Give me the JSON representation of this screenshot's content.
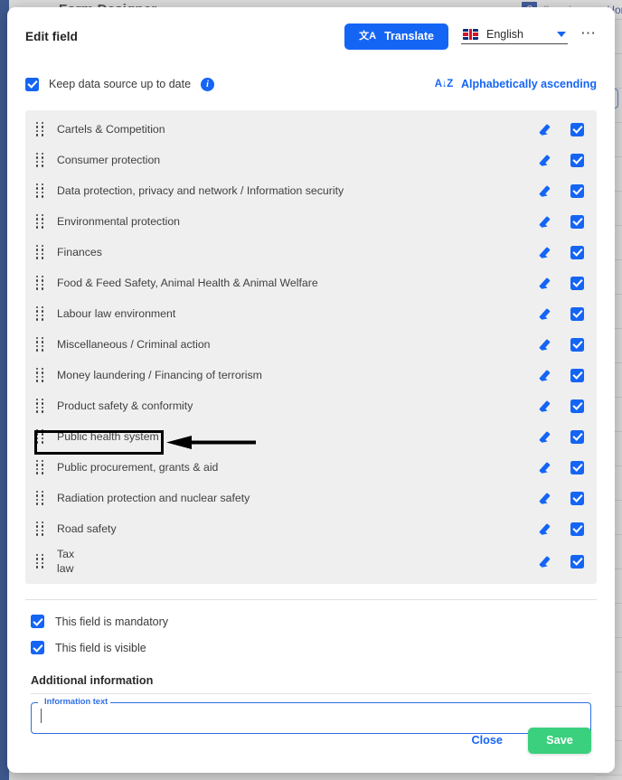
{
  "background": {
    "app_title": "Form Designer",
    "search_placeholder": "Search",
    "nav_home": "Home",
    "nav_next": "S",
    "search_icon": "search-icon"
  },
  "dialog": {
    "title": "Edit field",
    "translate_button": "Translate",
    "translate_icon": "translate-icon",
    "language": "English",
    "language_flag": "uk-flag-icon",
    "dropdown_icon": "chevron-down-icon",
    "more_icon": "ellipsis-icon",
    "keep_updated_label": "Keep data source up to date",
    "keep_updated_checked": true,
    "info_icon": "info-icon",
    "sort_icon": "sort-alpha-down-icon",
    "sort_label": "Alphabetically ascending",
    "mandatory_label": "This field is mandatory",
    "mandatory_checked": true,
    "visible_label": "This field is visible",
    "visible_checked": true,
    "additional_title": "Additional information",
    "info_text_legend": "Information text",
    "info_text_value": "",
    "close_button": "Close",
    "save_button": "Save",
    "accent_blue": "#1565f5",
    "save_green": "#3ad07e",
    "list_background": "#efefef"
  },
  "options": [
    {
      "label": "Cartels & Competition",
      "checked": true,
      "highlighted": false
    },
    {
      "label": "Consumer protection",
      "checked": true,
      "highlighted": false
    },
    {
      "label": "Data protection, privacy and network / Information security",
      "checked": true,
      "highlighted": false
    },
    {
      "label": "Environmental protection",
      "checked": true,
      "highlighted": false
    },
    {
      "label": "Finances",
      "checked": true,
      "highlighted": false
    },
    {
      "label": "Food & Feed Safety, Animal Health & Animal Welfare",
      "checked": true,
      "highlighted": false
    },
    {
      "label": "Labour law environment",
      "checked": true,
      "highlighted": false
    },
    {
      "label": "Miscellaneous / Criminal action",
      "checked": true,
      "highlighted": false
    },
    {
      "label": "Money laundering / Financing of terrorism",
      "checked": true,
      "highlighted": false
    },
    {
      "label": "Product safety & conformity",
      "checked": true,
      "highlighted": false
    },
    {
      "label": "Public health system",
      "checked": true,
      "highlighted": true
    },
    {
      "label": "Public procurement, grants & aid",
      "checked": true,
      "highlighted": false
    },
    {
      "label": "Radiation protection and nuclear safety",
      "checked": true,
      "highlighted": false
    },
    {
      "label": "Road safety",
      "checked": true,
      "highlighted": false
    },
    {
      "label": "Tax\nlaw",
      "checked": true,
      "highlighted": false
    }
  ],
  "annotation": {
    "target": "Public health system",
    "arrow_direction": "left"
  }
}
